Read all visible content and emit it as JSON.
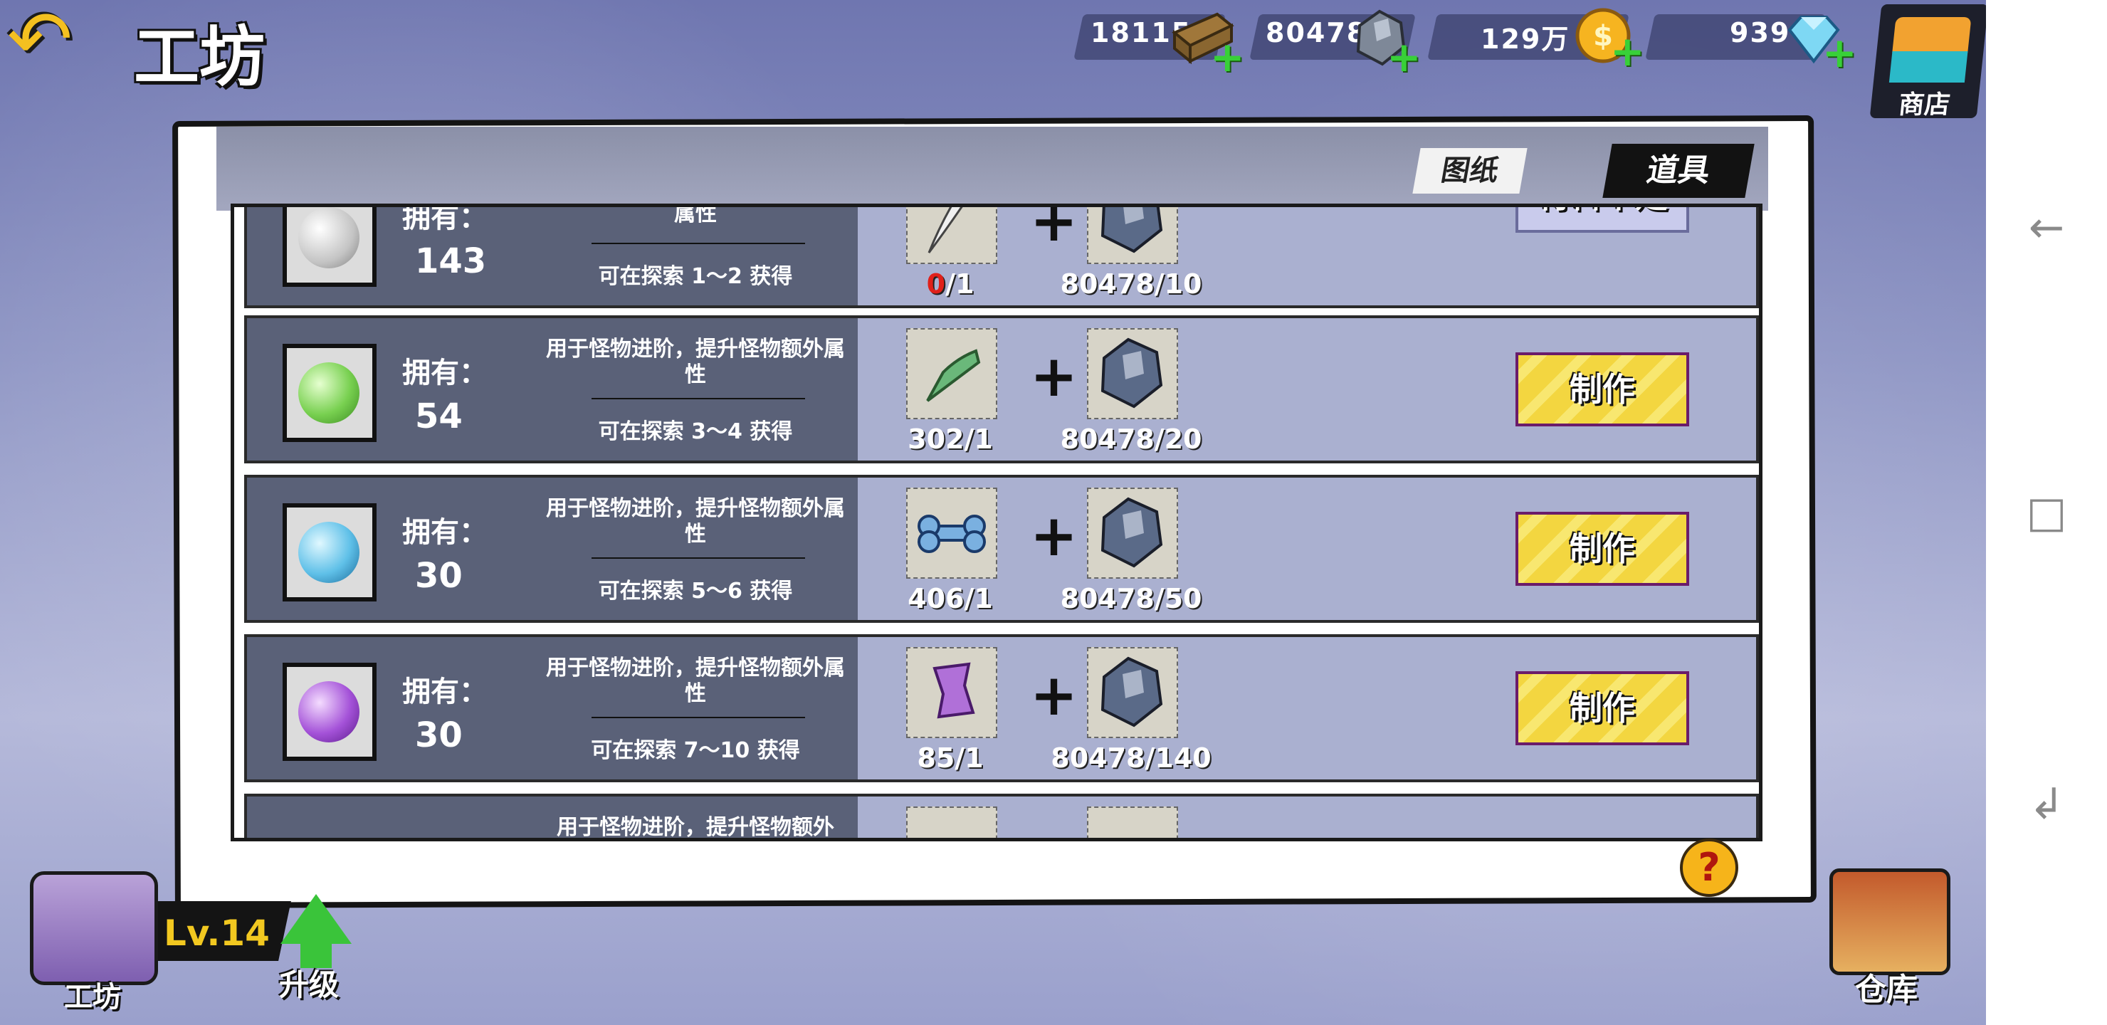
{
  "header": {
    "title": "工坊",
    "resources": [
      {
        "value": "18115",
        "icon": "wood-plank-icon"
      },
      {
        "value": "80478",
        "icon": "ore-crystal-icon"
      },
      {
        "value": "129万",
        "icon": "gold-coin-icon"
      },
      {
        "value": "939",
        "icon": "diamond-icon"
      }
    ],
    "shop_label": "商店"
  },
  "tabs": {
    "blueprint": "图纸",
    "items": "道具"
  },
  "rows": [
    {
      "own_label": "拥有：",
      "owned": "143",
      "desc": "属性",
      "source": "可在探索 1～2 获得",
      "mat1_have": "0",
      "mat1_need": "/1",
      "mat2_count": "80478/10",
      "action": "材料不足",
      "orb_color": "#c4c4c4"
    },
    {
      "own_label": "拥有：",
      "owned": "54",
      "desc": "用于怪物进阶，提升怪物额外属性",
      "source": "可在探索 3～4 获得",
      "mat1_count": "302/1",
      "mat2_count": "80478/20",
      "action": "制作",
      "orb_color": "#78d050"
    },
    {
      "own_label": "拥有：",
      "owned": "30",
      "desc": "用于怪物进阶，提升怪物额外属性",
      "source": "可在探索 5～6 获得",
      "mat1_count": "406/1",
      "mat2_count": "80478/50",
      "action": "制作",
      "orb_color": "#5fc0e8"
    },
    {
      "own_label": "拥有：",
      "owned": "30",
      "desc": "用于怪物进阶，提升怪物额外属性",
      "source": "可在探索 7～10 获得",
      "mat1_count": "85/1",
      "mat2_count": "80478/140",
      "action": "制作",
      "orb_color": "#a452d8"
    },
    {
      "desc": "用于怪物进阶，提升怪物额外"
    }
  ],
  "help_label": "?",
  "workshop": {
    "label": "工坊",
    "level": "Lv.14"
  },
  "upgrade_label": "升级",
  "warehouse_label": "仓库",
  "colors": {
    "make_button": "#f3d640",
    "insufficient_button": "#c9cbec",
    "row_bg": "#aab0d0",
    "row_left": "#5a6178",
    "missing_red": "#e0201a"
  }
}
